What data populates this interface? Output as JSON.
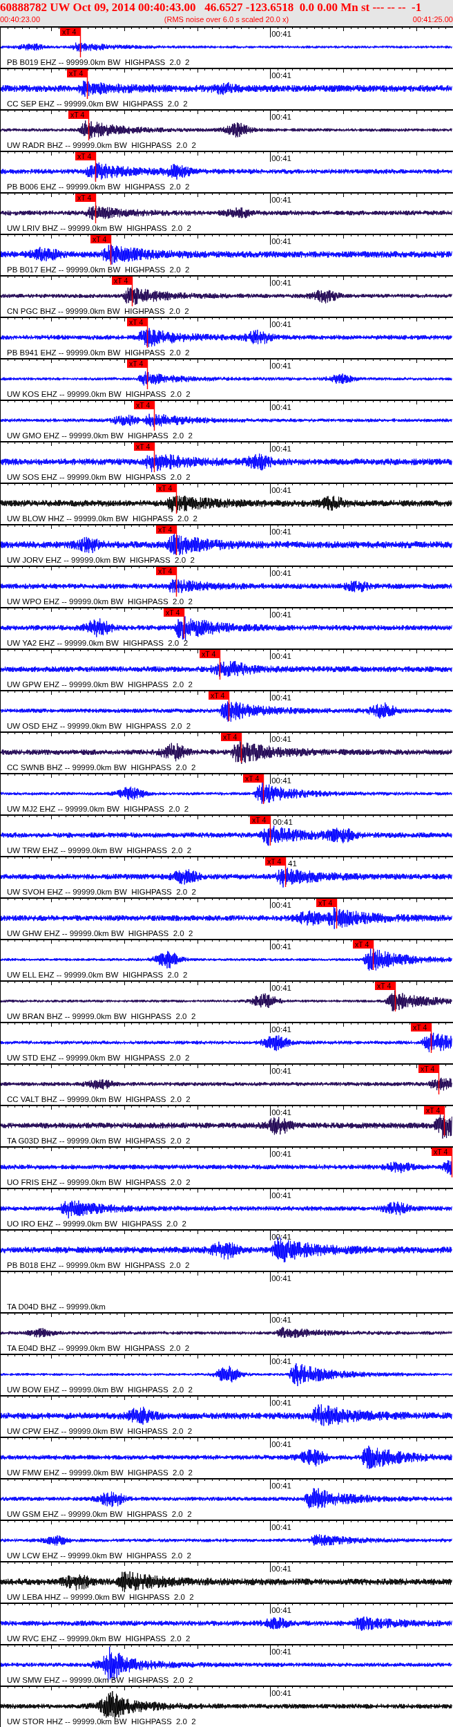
{
  "header": {
    "title": "60888782 UW Oct 09, 2014 00:40:43.00   46.6527 -123.6518  0.0 0.00 Mn st --- -- --  -1",
    "start_time": "00:40:23.00",
    "note": "(RMS noise over 6.0 s scaled 20.0 x)",
    "end_time": "00:41:25.00"
  },
  "traces": [
    {
      "label": "PB B019 EHZ -- 99999.0km BW  HIGHPASS  2.0  2",
      "time_mark": "00:41",
      "pick": "xT 4",
      "level": 0.177,
      "color": "#0000ff",
      "kind": "waveform"
    },
    {
      "label": "CC SEP EHZ -- 99999.0km BW  HIGHPASS  2.0  2",
      "time_mark": "00:41",
      "pick": "xT 4",
      "level": 0.192,
      "color": "#0000ff",
      "kind": "waveform"
    },
    {
      "label": "UW RADR BHZ -- 99999.0km BW  HIGHPASS  2.0  2",
      "time_mark": "00:41",
      "pick": "xT 4",
      "level": 0.195,
      "color": "#1c0050",
      "kind": "waveform"
    },
    {
      "label": "PB B006 EHZ -- 99999.0km BW  HIGHPASS  2.0  2",
      "time_mark": "00:41",
      "pick": "xT 4",
      "level": 0.21,
      "color": "#0000ff",
      "kind": "waveform"
    },
    {
      "label": "UW LRIV BHZ -- 99999.0km BW  HIGHPASS  2.0  2",
      "time_mark": "00:41",
      "pick": "xT 4",
      "level": 0.21,
      "color": "#1c0050",
      "kind": "waveform"
    },
    {
      "label": "PB B017 EHZ -- 99999.0km BW  HIGHPASS  2.0  2",
      "time_mark": "00:41",
      "pick": "xT 4",
      "level": 0.244,
      "color": "#0000ff",
      "kind": "waveform"
    },
    {
      "label": "CN PGC BHZ -- 99999.0km BW  HIGHPASS  2.0  2",
      "time_mark": "00:41",
      "pick": "xT 4",
      "level": 0.291,
      "color": "#1c0050",
      "kind": "waveform"
    },
    {
      "label": "PB B941 EHZ -- 99999.0km BW  HIGHPASS  2.0  2",
      "time_mark": "00:41",
      "pick": "xT 4",
      "level": 0.325,
      "color": "#0000ff",
      "kind": "waveform"
    },
    {
      "label": "UW KOS EHZ -- 99999.0km BW  HIGHPASS  2.0  2",
      "time_mark": "00:41",
      "pick": "xT 4",
      "level": 0.325,
      "color": "#0000ff",
      "kind": "waveform"
    },
    {
      "label": "UW GMO EHZ -- 99999.0km BW  HIGHPASS  2.0  2",
      "time_mark": "00:41",
      "pick": "xT 4",
      "level": 0.34,
      "color": "#0000ff",
      "kind": "waveform"
    },
    {
      "label": "UW SOS EHZ -- 99999.0km BW  HIGHPASS  2.0  2",
      "time_mark": "00:41",
      "pick": "xT 4",
      "level": 0.34,
      "color": "#0000ff",
      "kind": "waveform"
    },
    {
      "label": "UW BLOW HHZ -- 99999.0km BW  HIGHPASS  2.0  2",
      "time_mark": "00:41",
      "pick": "xT 4",
      "level": 0.389,
      "color": "#000000",
      "kind": "waveform"
    },
    {
      "label": "UW JORV EHZ -- 99999.0km BW  HIGHPASS  2.0  2",
      "time_mark": "00:41",
      "pick": "xT 4",
      "level": 0.389,
      "color": "#0000ff",
      "kind": "waveform"
    },
    {
      "label": "UW WPO EHZ -- 99999.0km BW  HIGHPASS  2.0  2",
      "time_mark": "00:41",
      "pick": "xT 4",
      "level": 0.389,
      "color": "#0000ff",
      "kind": "waveform"
    },
    {
      "label": "UW YA2 EHZ -- 99999.0km BW  HIGHPASS  2.0  2",
      "time_mark": "00:41",
      "pick": "xT 4",
      "level": 0.405,
      "color": "#0000ff",
      "kind": "waveform"
    },
    {
      "label": "UW GPW EHZ -- 99999.0km BW  HIGHPASS  2.0  2",
      "time_mark": "00:41",
      "pick": "xT 4",
      "level": 0.485,
      "color": "#0000ff",
      "kind": "waveform"
    },
    {
      "label": "UW OSD EHZ -- 99999.0km BW  HIGHPASS  2.0  2",
      "time_mark": "00:41",
      "pick": "xT 4",
      "level": 0.505,
      "color": "#0000ff",
      "kind": "waveform"
    },
    {
      "label": "CC SWNB BHZ -- 99999.0km BW  HIGHPASS  2.0  2",
      "time_mark": "00:41",
      "pick": "xT 4",
      "level": 0.532,
      "color": "#1c0050",
      "kind": "waveform"
    },
    {
      "label": "UW MJ2 EHZ -- 99999.0km BW  HIGHPASS  2.0  2",
      "time_mark": "00:41",
      "pick": "xT 4",
      "level": 0.581,
      "color": "#0000ff",
      "kind": "waveform"
    },
    {
      "label": "UW TRW EHZ -- 99999.0km BW  HIGHPASS  2.0  2",
      "time_mark": "00:41",
      "pick": "xT 4",
      "level": 0.596,
      "color": "#0000ff",
      "kind": "waveform"
    },
    {
      "label": "UW SVOH EHZ -- 99999.0km BW  HIGHPASS  2.0  2",
      "time_mark": "41",
      "pick": "xT 4",
      "level": 0.63,
      "color": "#0000ff",
      "kind": "waveform"
    },
    {
      "label": "UW GHW EHZ -- 99999.0km BW  HIGHPASS  2.0  2",
      "time_mark": "00:41",
      "pick": "xT 4",
      "level": 0.742,
      "color": "#0000ff",
      "kind": "waveform"
    },
    {
      "label": "UW ELL EHZ -- 99999.0km BW  HIGHPASS  2.0  2",
      "time_mark": "00:41",
      "pick": "xT 4",
      "level": 0.823,
      "color": "#0000ff",
      "kind": "waveform"
    },
    {
      "label": "UW BRAN BHZ -- 99999.0km BW  HIGHPASS  2.0  2",
      "time_mark": "00:41",
      "pick": "xT 4",
      "level": 0.872,
      "color": "#1c0050",
      "kind": "waveform"
    },
    {
      "label": "UW STD EHZ -- 99999.0km BW  HIGHPASS  2.0  2",
      "time_mark": "00:41",
      "pick": "xT 4",
      "level": 0.951,
      "color": "#0000ff",
      "kind": "waveform"
    },
    {
      "label": "CC VALT BHZ -- 99999.0km BW  HIGHPASS  2.0  2",
      "time_mark": "00:41",
      "pick": "xT 4",
      "level": 0.968,
      "color": "#1c0050",
      "kind": "waveform"
    },
    {
      "label": "TA G03D BHZ -- 99999.0km BW  HIGHPASS  2.0  2",
      "time_mark": "00:41",
      "pick": "xT 4",
      "level": 0.98,
      "color": "#1c0050",
      "kind": "waveform"
    },
    {
      "label": "UO FRIS EHZ -- 99999.0km BW  HIGHPASS  2.0  2",
      "time_mark": "00:41",
      "pick": "xT 4",
      "level": 0.997,
      "color": "#0000ff",
      "kind": "waveform"
    },
    {
      "label": "UO IRO EHZ -- 99999.0km BW  HIGHPASS  2.0  2",
      "time_mark": "00:41",
      "color": "#0000ff",
      "kind": "waveform"
    },
    {
      "label": "PB B018 EHZ -- 99999.0km BW  HIGHPASS  2.0  2",
      "time_mark": "00:41",
      "color": "#0000ff",
      "kind": "waveform"
    },
    {
      "label": "TA D04D BHZ -- 99999.0km",
      "time_mark": "00:41",
      "kind": "blank"
    },
    {
      "label": "TA E04D BHZ -- 99999.0km BW  HIGHPASS  2.0  2",
      "time_mark": "00:41",
      "color": "#1c0050",
      "kind": "waveform"
    },
    {
      "label": "UW BOW EHZ -- 99999.0km BW  HIGHPASS  2.0  2",
      "time_mark": "00:41",
      "color": "#0000ff",
      "kind": "waveform"
    },
    {
      "label": "UW CPW EHZ -- 99999.0km BW  HIGHPASS  2.0  2",
      "time_mark": "00:41",
      "color": "#0000ff",
      "kind": "waveform"
    },
    {
      "label": "UW FMW EHZ -- 99999.0km BW  HIGHPASS  2.0  2",
      "time_mark": "00:41",
      "color": "#0000ff",
      "kind": "waveform"
    },
    {
      "label": "UW GSM EHZ -- 99999.0km BW  HIGHPASS  2.0  2",
      "time_mark": "00:41",
      "color": "#0000ff",
      "kind": "waveform"
    },
    {
      "label": "UW LCW EHZ -- 99999.0km BW  HIGHPASS  2.0  2",
      "time_mark": "00:41",
      "color": "#0000ff",
      "kind": "waveform"
    },
    {
      "label": "UW LEBA HHZ -- 99999.0km BW  HIGHPASS  2.0  2",
      "time_mark": "00:41",
      "color": "#000000",
      "kind": "waveform"
    },
    {
      "label": "UW RVC EHZ -- 99999.0km BW  HIGHPASS  2.0  2",
      "time_mark": "00:41",
      "color": "#0000ff",
      "kind": "waveform"
    },
    {
      "label": "UW SMW EHZ -- 99999.0km BW  HIGHPASS  2.0  2",
      "time_mark": "00:41",
      "color": "#0000ff",
      "kind": "waveform"
    },
    {
      "label": "UW STOR HHZ -- 99999.0km BW  HIGHPASS  2.0  2",
      "time_mark": "00:41",
      "color": "#000000",
      "kind": "waveform"
    }
  ]
}
